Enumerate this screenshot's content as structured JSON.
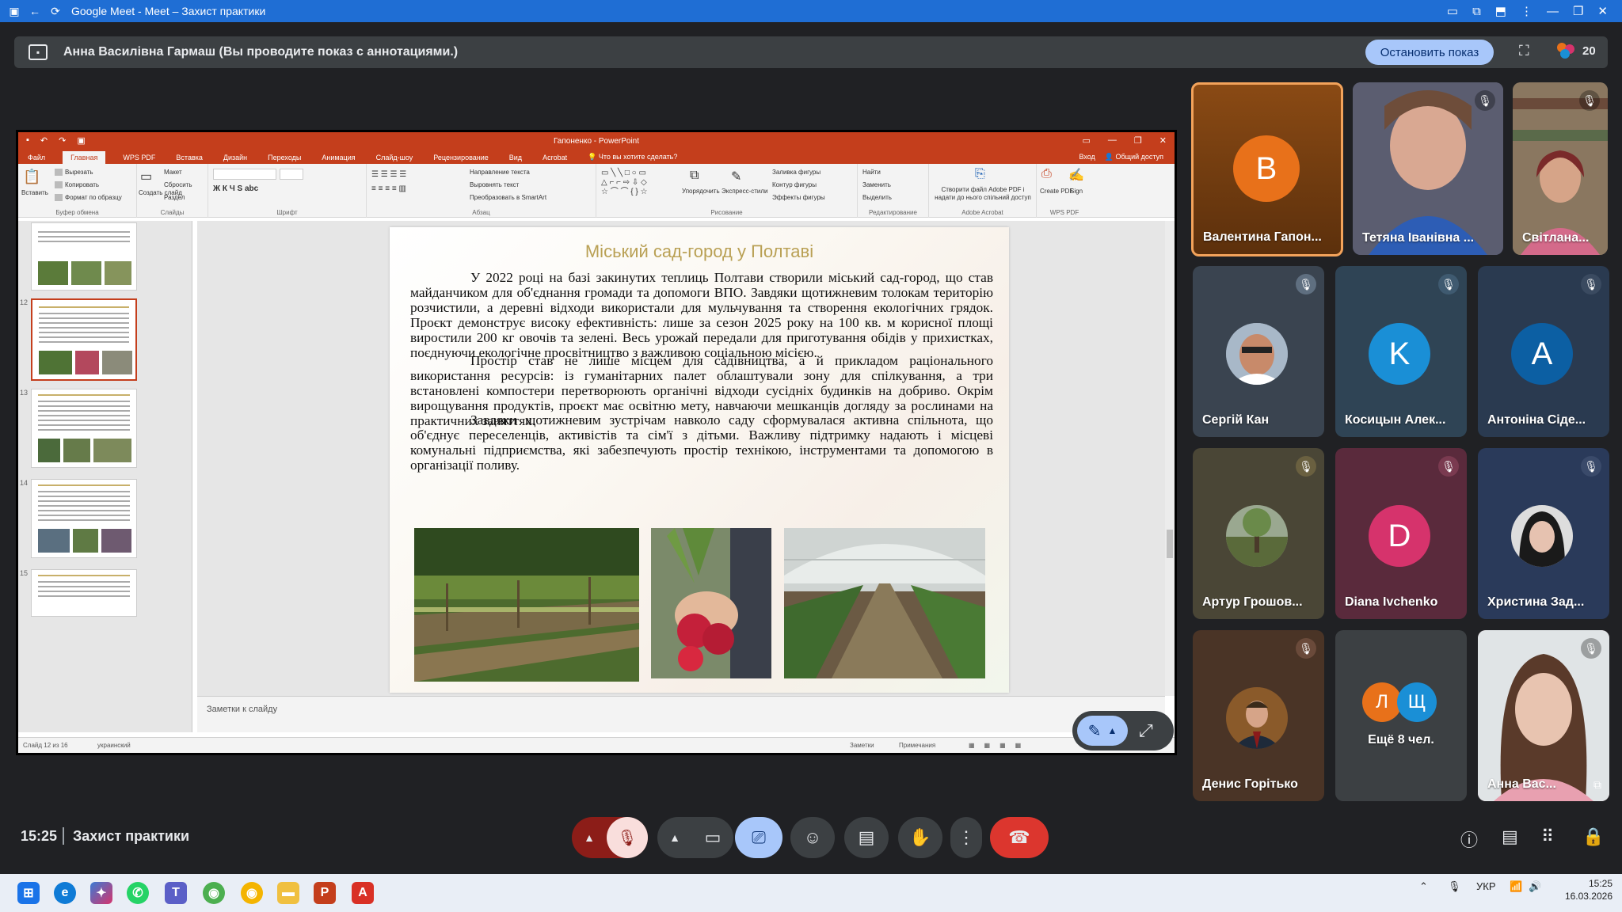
{
  "browser": {
    "title": "Google Meet - Meet – Захист практики",
    "back_icon": "arrow-left-icon",
    "reload_icon": "reload-icon"
  },
  "banner": {
    "text": "Анна Василівна Гармаш (Вы проводите показ с аннотациями.)",
    "stop_label": "Остановить показ",
    "people_count": "20"
  },
  "ppt": {
    "window_title": "Гапоненко - PowerPoint",
    "tabs": [
      "Файл",
      "Главная",
      "WPS PDF",
      "Вставка",
      "Дизайн",
      "Переходы",
      "Анимация",
      "Слайд-шоу",
      "Рецензирование",
      "Вид",
      "Acrobat"
    ],
    "active_tab": "Главная",
    "search_hint": "Что вы хотите сделать?",
    "login": "Вход",
    "share": "Общий доступ",
    "ribbon": {
      "paste": "Вставить",
      "cut": "Вырезать",
      "copy": "Копировать",
      "format_painter": "Формат по образцу",
      "clipboard": "Буфер обмена",
      "new_slide": "Создать слайд",
      "layout": "Макет",
      "reset": "Сбросить",
      "section": "Раздел",
      "slides": "Слайды",
      "font": "Шрифт",
      "paragraph": "Абзац",
      "text_direction": "Направление текста",
      "align_text": "Выровнять текст",
      "smartart": "Преобразовать в SmartArt",
      "arrange": "Упорядочить",
      "quick_styles": "Экспресс-стили",
      "shape_fill": "Заливка фигуры",
      "shape_outline": "Контур фигуры",
      "shape_effects": "Эффекты фигуры",
      "drawing": "Рисование",
      "find": "Найти",
      "replace": "Заменить",
      "select": "Выделить",
      "editing": "Редактирование",
      "adobe_create": "Створити файл Adobe PDF і надати до нього спільний доступ",
      "adobe_acrobat": "Adobe Acrobat",
      "create_pdf": "Create PDF",
      "sign": "Sign",
      "wps_pdf": "WPS PDF"
    },
    "thumb_numbers": [
      "12",
      "13",
      "14",
      "15"
    ],
    "slide": {
      "title": "Міський сад-город у Полтаві",
      "paragraphs": [
        "У 2022 році на базі закинутих теплиць Полтави створили міський сад-город, що став майданчиком для об'єднання громади та допомоги ВПО. Завдяки щотижневим толокам територію розчистили, а деревні відходи використали для мульчування та створення екологічних грядок. Проєкт демонструє високу ефективність: лише за сезон 2025 року на 100 кв. м корисної площі виростили 200 кг овочів та зелені. Весь урожай передали для приготування обідів у прихистках, поєднуючи екологічне просвітництво з важливою соціальною місією.",
        "Простір став не лише місцем для садівництва, а й прикладом раціонального використання ресурсів: із гуманітарних палет облаштували зону для спілкування, а три встановлені компостери перетворюють органічні відходи сусідніх будинків на добриво. Окрім вирощування продуктів, проєкт має освітню мету, навчаючи мешканців догляду за рослинами на практичних заняттях.",
        "Завдяки щотижневим зустрічам навколо саду сформувалася активна спільнота, що об'єднує переселенців, активістів та сім'ї з дітьми. Важливу підтримку надають і місцеві комунальні підприємства, які забезпечують простір технікою, інструментами та допомогою в організації поливу."
      ]
    },
    "notes_placeholder": "Заметки к слайду",
    "status": {
      "slide_of": "Слайд 12 из 16",
      "language": "украинский",
      "notes": "Заметки",
      "comments": "Примечания"
    }
  },
  "participants": [
    {
      "name": "Валентина Гапон...",
      "initial": "В",
      "color": "#e8711a",
      "bg": "#7a3d10",
      "speaking": true
    },
    {
      "name": "Тетяна Іванівна ...",
      "video": true
    },
    {
      "name": "Світлана...",
      "video": true
    },
    {
      "name": "Сергій Кан",
      "photo": true
    },
    {
      "name": "Косицын Алек...",
      "initial": "K",
      "color": "#1a8fd6",
      "bg": "#2f4455"
    },
    {
      "name": "Антоніна Сіде...",
      "initial": "A",
      "color": "#0c5fa3",
      "bg": "#2a3a50"
    },
    {
      "name": "Артур Грошов...",
      "photo": true
    },
    {
      "name": "Diana Ivchenko",
      "initial": "D",
      "color": "#d6336c",
      "bg": "#5a2a3c"
    },
    {
      "name": "Христина Зад...",
      "photo": true
    },
    {
      "name": "Денис Горітько",
      "photo": true
    },
    {
      "name": "Ещё 8 чел.",
      "initials": [
        "Л",
        "Щ"
      ]
    },
    {
      "name": "Анна Вас...",
      "video": true
    }
  ],
  "bottom": {
    "time": "15:25",
    "meeting": "Захист практики"
  },
  "taskbar": {
    "lang": "УКР",
    "time": "15:25",
    "date": "16.03.2026"
  }
}
